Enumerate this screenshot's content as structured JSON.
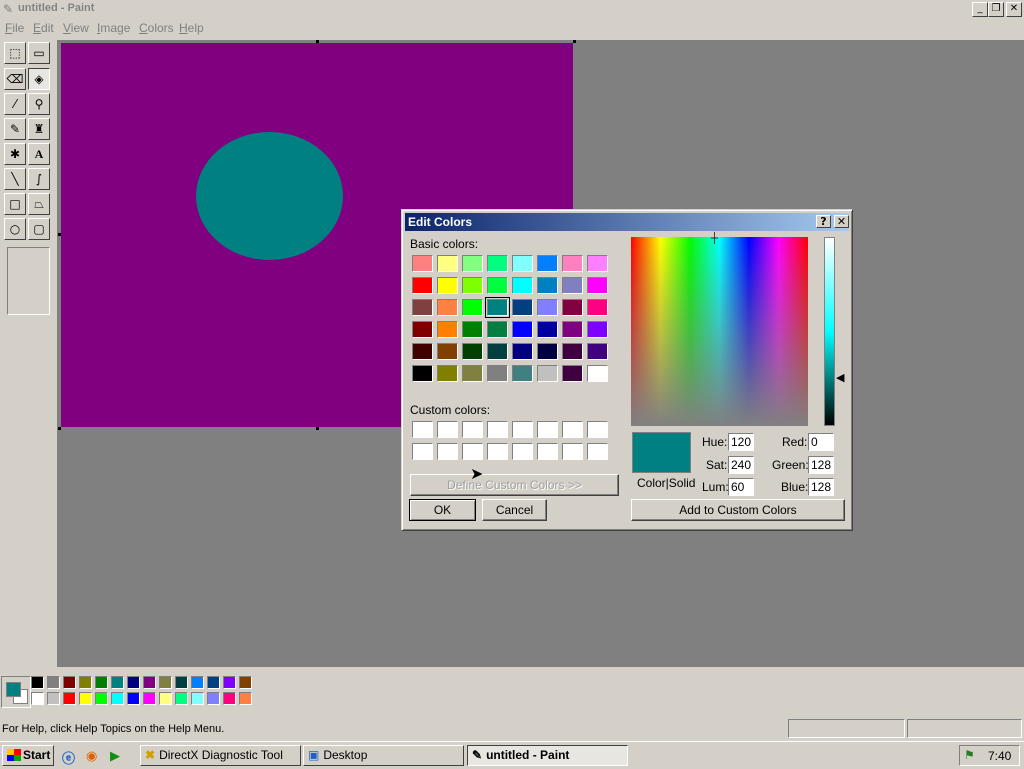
{
  "window": {
    "title": "untitled - Paint"
  },
  "menu": [
    {
      "first": "F",
      "rest": "ile"
    },
    {
      "first": "E",
      "rest": "dit"
    },
    {
      "first": "V",
      "rest": "iew"
    },
    {
      "first": "I",
      "rest": "mage"
    },
    {
      "first": "C",
      "rest": "olors"
    },
    {
      "first": "H",
      "rest": "elp"
    }
  ],
  "canvas": {
    "background": "#800080",
    "shape_color": "#008080"
  },
  "palette": {
    "foreground": "#008080",
    "background": "#FFFFFF",
    "row1": [
      "#000000",
      "#808080",
      "#800000",
      "#808000",
      "#008000",
      "#008080",
      "#000080",
      "#800080",
      "#808040",
      "#004040",
      "#0080FF",
      "#004080",
      "#8000FF",
      "#804000"
    ],
    "row2": [
      "#FFFFFF",
      "#C0C0C0",
      "#FF0000",
      "#FFFF00",
      "#00FF00",
      "#00FFFF",
      "#0000FF",
      "#FF00FF",
      "#FFFF80",
      "#00FF80",
      "#80FFFF",
      "#8080FF",
      "#FF0080",
      "#FF8040"
    ]
  },
  "status": {
    "help_text": "For Help, click Help Topics on the Help Menu."
  },
  "taskbar": {
    "start": "Start",
    "buttons": [
      "DirectX Diagnostic Tool",
      "Desktop",
      "untitled - Paint"
    ],
    "clock": "7:40"
  },
  "dialog": {
    "title": "Edit Colors",
    "help_btn": "?",
    "close_btn": "✕",
    "basic_label": "Basic colors:",
    "basic_colors": [
      [
        "#FF8080",
        "#FFFF80",
        "#80FF80",
        "#00FF80",
        "#80FFFF",
        "#0080FF",
        "#FF80C0",
        "#FF80FF"
      ],
      [
        "#FF0000",
        "#FFFF00",
        "#80FF00",
        "#00FF40",
        "#00FFFF",
        "#0080C0",
        "#8080C0",
        "#FF00FF"
      ],
      [
        "#804040",
        "#FF8040",
        "#00FF00",
        "#008080",
        "#004080",
        "#8080FF",
        "#800040",
        "#FF0080"
      ],
      [
        "#800000",
        "#FF8000",
        "#008000",
        "#008040",
        "#0000FF",
        "#0000A0",
        "#800080",
        "#8000FF"
      ],
      [
        "#400000",
        "#804000",
        "#004000",
        "#004040",
        "#000080",
        "#000040",
        "#400040",
        "#400080"
      ],
      [
        "#000000",
        "#808000",
        "#808040",
        "#808080",
        "#408080",
        "#C0C0C0",
        "#400040",
        "#FFFFFF"
      ]
    ],
    "custom_label": "Custom colors:",
    "define_btn": "Define Custom Colors >>",
    "ok": "OK",
    "cancel": "Cancel",
    "color_solid": "Color|Solid",
    "hue_label": "Hue:",
    "hue": "120",
    "sat_label": "Sat:",
    "sat": "240",
    "lum_label": "Lum:",
    "lum": "60",
    "red_label": "Red:",
    "red": "0",
    "green_label": "Green:",
    "green": "128",
    "blue_label": "Blue:",
    "blue": "128",
    "add_btn": "Add to Custom Colors",
    "current_color": "#008080"
  }
}
